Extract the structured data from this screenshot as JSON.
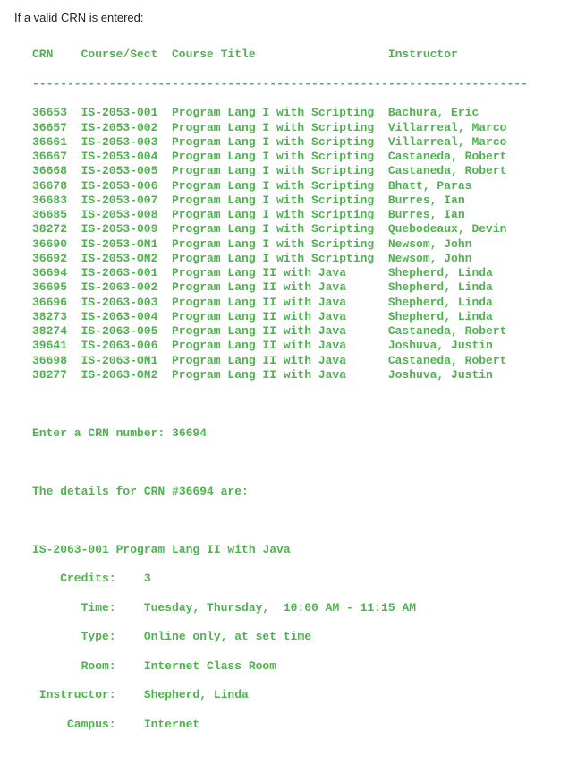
{
  "intro": "If a valid CRN is entered:",
  "header": {
    "crn": "CRN",
    "sect": "Course/Sect",
    "title": "Course Title",
    "inst": "Instructor"
  },
  "dash": "-----------------------------------------------------------------------",
  "rows": [
    {
      "crn": "36653",
      "sect": "IS-2053-001",
      "title": "Program Lang I with Scripting",
      "inst": "Bachura, Eric"
    },
    {
      "crn": "36657",
      "sect": "IS-2053-002",
      "title": "Program Lang I with Scripting",
      "inst": "Villarreal, Marco"
    },
    {
      "crn": "36661",
      "sect": "IS-2053-003",
      "title": "Program Lang I with Scripting",
      "inst": "Villarreal, Marco"
    },
    {
      "crn": "36667",
      "sect": "IS-2053-004",
      "title": "Program Lang I with Scripting",
      "inst": "Castaneda, Robert"
    },
    {
      "crn": "36668",
      "sect": "IS-2053-005",
      "title": "Program Lang I with Scripting",
      "inst": "Castaneda, Robert"
    },
    {
      "crn": "36678",
      "sect": "IS-2053-006",
      "title": "Program Lang I with Scripting",
      "inst": "Bhatt, Paras"
    },
    {
      "crn": "36683",
      "sect": "IS-2053-007",
      "title": "Program Lang I with Scripting",
      "inst": "Burres, Ian"
    },
    {
      "crn": "36685",
      "sect": "IS-2053-008",
      "title": "Program Lang I with Scripting",
      "inst": "Burres, Ian"
    },
    {
      "crn": "38272",
      "sect": "IS-2053-009",
      "title": "Program Lang I with Scripting",
      "inst": "Quebodeaux, Devin"
    },
    {
      "crn": "36690",
      "sect": "IS-2053-ON1",
      "title": "Program Lang I with Scripting",
      "inst": "Newsom, John"
    },
    {
      "crn": "36692",
      "sect": "IS-2053-ON2",
      "title": "Program Lang I with Scripting",
      "inst": "Newsom, John"
    },
    {
      "crn": "36694",
      "sect": "IS-2063-001",
      "title": "Program Lang II with Java",
      "inst": "Shepherd, Linda"
    },
    {
      "crn": "36695",
      "sect": "IS-2063-002",
      "title": "Program Lang II with Java",
      "inst": "Shepherd, Linda"
    },
    {
      "crn": "36696",
      "sect": "IS-2063-003",
      "title": "Program Lang II with Java",
      "inst": "Shepherd, Linda"
    },
    {
      "crn": "38273",
      "sect": "IS-2063-004",
      "title": "Program Lang II with Java",
      "inst": "Shepherd, Linda"
    },
    {
      "crn": "38274",
      "sect": "IS-2063-005",
      "title": "Program Lang II with Java",
      "inst": "Castaneda, Robert"
    },
    {
      "crn": "39641",
      "sect": "IS-2063-006",
      "title": "Program Lang II with Java",
      "inst": "Joshuva, Justin"
    },
    {
      "crn": "36698",
      "sect": "IS-2063-ON1",
      "title": "Program Lang II with Java",
      "inst": "Castaneda, Robert"
    },
    {
      "crn": "38277",
      "sect": "IS-2063-ON2",
      "title": "Program Lang II with Java",
      "inst": "Joshuva, Justin"
    }
  ],
  "prompt2": "Enter a CRN number: 36694",
  "detail_header": "The details for CRN #36694 are:",
  "detail_course": "IS-2063-001 Program Lang II with Java",
  "details": {
    "credits_label": "Credits:",
    "credits": "3",
    "time_label": "Time:",
    "time": "Tuesday, Thursday,  10:00 AM - 11:15 AM",
    "type_label": "Type:",
    "type": "Online only, at set time",
    "room_label": "Room:",
    "room": "Internet Class Room",
    "instructor_label": "Instructor:",
    "instructor": "Shepherd, Linda",
    "campus_label": "Campus:",
    "campus": "Internet"
  }
}
